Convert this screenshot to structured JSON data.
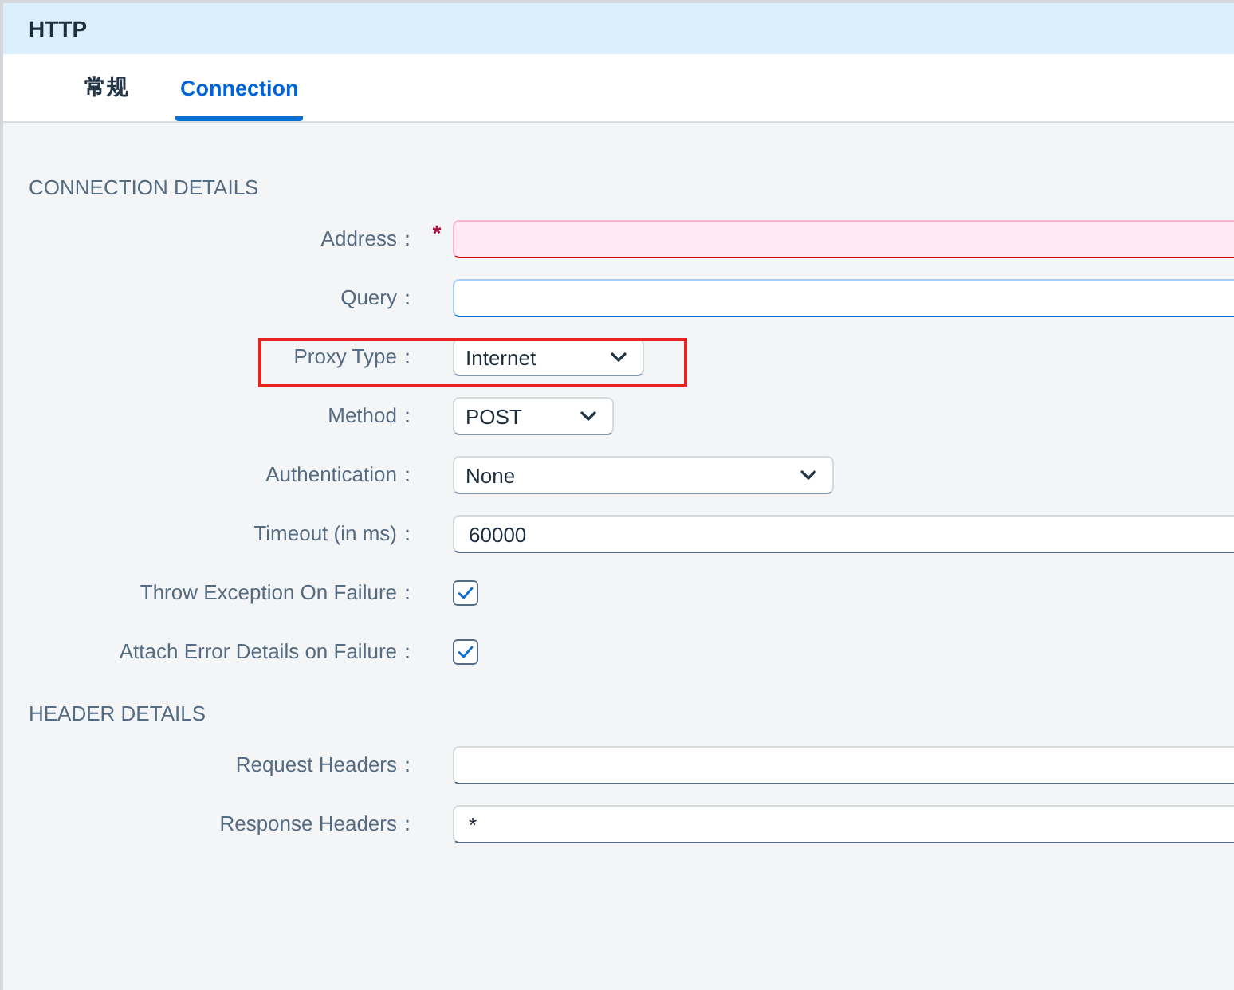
{
  "panel": {
    "title": "HTTP"
  },
  "tabs": [
    {
      "label": "常规",
      "selected": false
    },
    {
      "label": "Connection",
      "selected": true
    }
  ],
  "sections": [
    {
      "title": "CONNECTION DETAILS",
      "fields": [
        {
          "kind": "text",
          "label": "Address：",
          "required_mark": "*",
          "invalid": true,
          "focused": false,
          "highlighted": false
        },
        {
          "kind": "text",
          "label": "Query：",
          "invalid": false,
          "focused": true,
          "highlighted": false
        },
        {
          "kind": "select",
          "label": "Proxy Type：",
          "value": "Internet",
          "highlighted": true
        },
        {
          "kind": "select",
          "label": "Method：",
          "value": "POST",
          "highlighted": false
        },
        {
          "kind": "select",
          "label": "Authentication：",
          "value": "None",
          "highlighted": false
        },
        {
          "kind": "text",
          "label": "Timeout (in ms)：",
          "value": "60000",
          "invalid": false,
          "focused": false,
          "highlighted": false
        },
        {
          "kind": "checkbox",
          "label": "Throw Exception On Failure：",
          "checked": true,
          "highlighted": false
        },
        {
          "kind": "checkbox",
          "label": "Attach Error Details on Failure：",
          "checked": true,
          "highlighted": false
        }
      ]
    },
    {
      "title": "HEADER DETAILS",
      "fields": [
        {
          "kind": "text",
          "label": "Request Headers：",
          "invalid": false,
          "focused": false,
          "highlighted": false
        },
        {
          "kind": "text",
          "label": "Response Headers：",
          "value": "*",
          "invalid": false,
          "focused": false,
          "highlighted": false
        }
      ]
    }
  ]
}
